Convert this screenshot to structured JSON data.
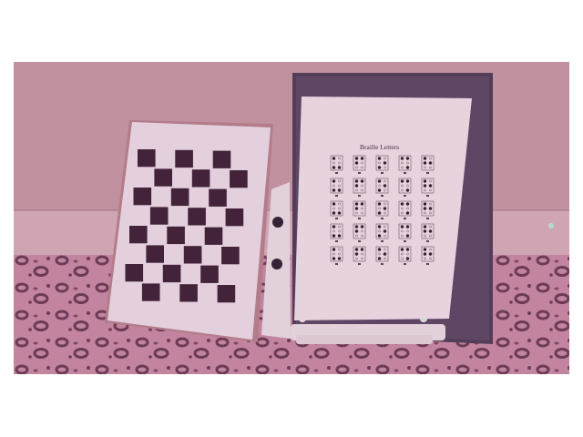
{
  "scene": {
    "wall_color": "#c99ca8",
    "baseboard_color": "#d7b3bd",
    "carpet_color": "#c98ea6",
    "carpet_spot_color": "#6a3d55",
    "tint_color": "#8a2f60"
  },
  "checkerboard": {
    "rows": 8,
    "cols": 6,
    "dark_color": "#3a2235",
    "light_color": "#efe2ea"
  },
  "braille_sheet": {
    "title": "Braille Letters",
    "rows": 5,
    "cols": 5,
    "cell_count": 25
  },
  "clipboard": {
    "board_color": "#4d3f58"
  },
  "stand": {
    "color": "#ece2e8"
  }
}
